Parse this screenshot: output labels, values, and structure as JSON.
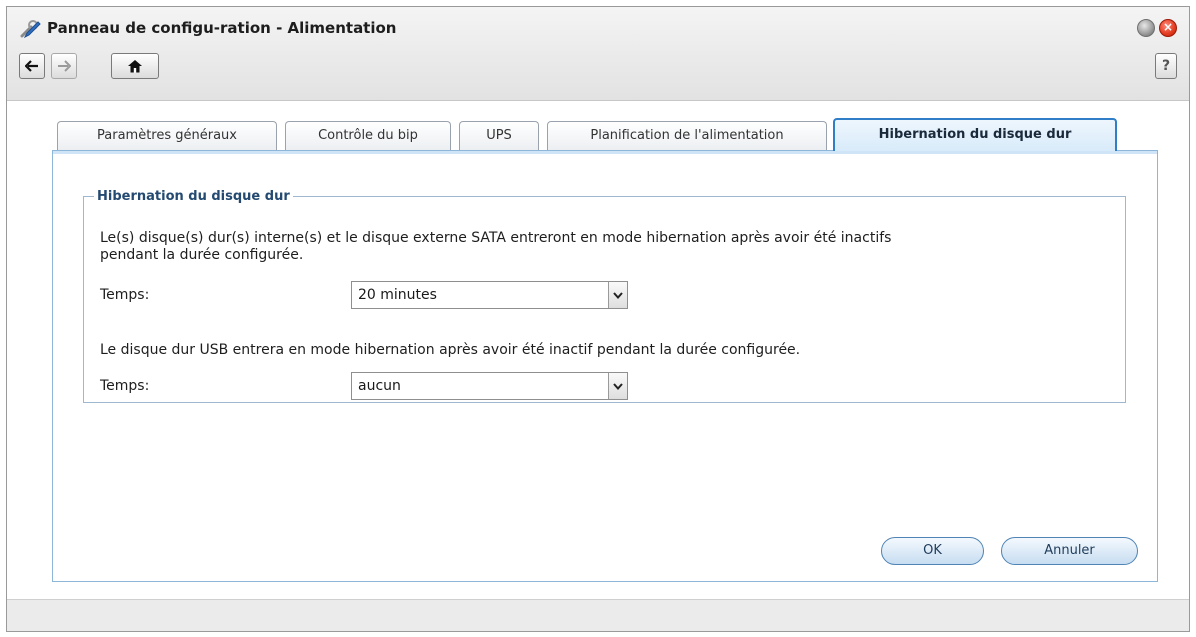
{
  "window": {
    "title": "Panneau de configu-ration - Alimentation",
    "app_icon": "control-panel-tools-icon"
  },
  "toolbar": {
    "back_icon": "arrow-left-icon",
    "forward_icon": "arrow-right-icon",
    "home_icon": "home-icon",
    "help_label": "?"
  },
  "tabs": [
    {
      "label": "Paramètres généraux",
      "active": false
    },
    {
      "label": "Contrôle du bip",
      "active": false
    },
    {
      "label": "UPS",
      "active": false
    },
    {
      "label": "Planification de l'alimentation",
      "active": false
    },
    {
      "label": "Hibernation du disque dur",
      "active": true
    }
  ],
  "section": {
    "legend": "Hibernation du disque dur",
    "internal_desc_line1": "Le(s) disque(s) dur(s) interne(s) et le disque externe SATA entreront en mode hibernation après avoir été inactifs",
    "internal_desc_line2": "pendant la durée configurée.",
    "internal_time_label": "Temps:",
    "internal_time_value": "20 minutes",
    "usb_desc": "Le disque dur USB entrera en mode hibernation après avoir été inactif pendant la durée configurée.",
    "usb_time_label": "Temps:",
    "usb_time_value": "aucun"
  },
  "buttons": {
    "ok": "OK",
    "cancel": "Annuler"
  },
  "colors": {
    "active_tab_border": "#2f7ec7",
    "legend_text": "#244a72",
    "close_button": "#e23a1f"
  }
}
